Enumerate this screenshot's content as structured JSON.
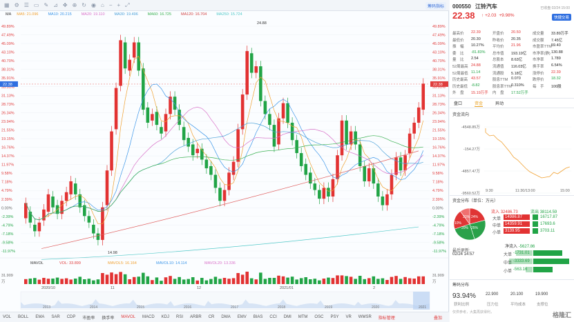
{
  "toolbar": {
    "label": "筹码指标",
    "icons": [
      "grid-icon",
      "settings-icon",
      "menu-icon",
      "screen-icon",
      "brush-icon",
      "ruler-icon",
      "cursor-icon",
      "zoom-icon",
      "refresh-icon",
      "eye-icon",
      "lock-icon",
      "minus-icon",
      "plus-icon",
      "expand-icon"
    ]
  },
  "ma": {
    "label": "MA",
    "items": [
      {
        "label": "MA5: 21.096",
        "color": "#f0a030"
      },
      {
        "label": "MA10: 20.215",
        "color": "#3a95e8"
      },
      {
        "label": "MA20: 19.110",
        "color": "#d870c8"
      },
      {
        "label": "MA30: 19.496",
        "color": "#4aa0d8"
      },
      {
        "label": "MA60: 16.725",
        "color": "#38b050"
      },
      {
        "label": "MA120: 16.704",
        "color": "#d04040"
      },
      {
        "label": "MA250: 15.724",
        "color": "#50c8c8"
      }
    ]
  },
  "vol": {
    "label": "MAVOL",
    "items": [
      {
        "label": "VOL: 33.899",
        "color": "#e03c3c"
      },
      {
        "label": "MAVOL5: 16.164",
        "color": "#f0a030"
      },
      {
        "label": "MAVOL10: 14.114",
        "color": "#3a95e8"
      },
      {
        "label": "MAVOL20: 13.336",
        "color": "#d870c8"
      }
    ],
    "axis_top": "31.909",
    "axis_unit": "万"
  },
  "chart_data": {
    "type": "candlestick",
    "left_ticks": [
      "49.89%",
      "47.49%",
      "45.09%",
      "43.10%",
      "40.70%",
      "38.31%",
      "35.91%",
      "33.51%",
      "31.13%",
      "28.73%",
      "26.34%",
      "23.94%",
      "21.55%",
      "19.15%",
      "16.76%",
      "14.37%",
      "11.97%",
      "9.58%",
      "7.18%",
      "4.79%",
      "2.39%",
      "0.00%",
      "-2.39%",
      "-4.79%",
      "-7.18%",
      "-9.58%",
      "-11.97%"
    ],
    "right_ticks": [
      "49.89%",
      "47.49%",
      "45.09%",
      "43.10%",
      "40.70%",
      "38.31%",
      "35.91%",
      "33.51%",
      "31.13%",
      "28.73%",
      "26.34%",
      "23.94%",
      "21.55%",
      "19.15%",
      "16.76%",
      "14.37%",
      "11.97%",
      "9.58%",
      "7.18%",
      "4.79%",
      "2.39%",
      "0.00%",
      "-2.39%",
      "-4.79%",
      "-7.18%",
      "-9.58%",
      "-11.97%"
    ],
    "current_price_label": "22.38",
    "high_label": "24.88",
    "low_label": "14.98",
    "x_labels_main": [
      "2020/10",
      "11",
      "12",
      "2021/01",
      "2"
    ],
    "x_labels_overview": [
      "2013",
      "2014",
      "2015",
      "2016",
      "2017",
      "2018",
      "2019",
      "2020",
      "2021"
    ],
    "candles": [
      [
        16.2,
        16.9
      ],
      [
        16.5,
        16.0
      ],
      [
        15.9,
        15.6
      ],
      [
        15.6,
        16.0
      ],
      [
        16.1,
        16.6
      ],
      [
        16.5,
        17.3
      ],
      [
        17.2,
        16.7
      ],
      [
        16.8,
        16.4
      ],
      [
        16.4,
        17.0
      ],
      [
        17.0,
        17.4
      ],
      [
        17.3,
        17.9
      ],
      [
        17.8,
        17.3
      ],
      [
        17.3,
        16.7
      ],
      [
        16.8,
        16.3
      ],
      [
        16.3,
        16.0
      ],
      [
        15.9,
        15.5
      ],
      [
        15.5,
        15.2
      ],
      [
        15.2,
        16.7
      ],
      [
        16.8,
        18.4
      ],
      [
        18.4,
        20.2
      ],
      [
        20.3,
        22.2
      ],
      [
        22.3,
        24.4
      ],
      [
        24.3,
        23.1
      ],
      [
        23.0,
        23.5
      ],
      [
        23.6,
        24.3
      ],
      [
        24.3,
        23.0
      ],
      [
        23.1,
        21.2
      ],
      [
        21.3,
        20.6
      ],
      [
        20.7,
        21.0
      ],
      [
        21.1,
        20.5
      ],
      [
        20.4,
        20.1
      ],
      [
        20.2,
        21.0
      ],
      [
        21.0,
        21.8
      ],
      [
        21.8,
        21.2
      ],
      [
        21.2,
        20.5
      ],
      [
        20.4,
        19.8
      ],
      [
        19.9,
        19.5
      ],
      [
        19.6,
        19.1
      ],
      [
        19.2,
        19.4
      ],
      [
        19.4,
        18.9
      ],
      [
        18.9,
        18.5
      ],
      [
        18.6,
        18.2
      ],
      [
        18.2,
        17.6
      ],
      [
        17.6,
        17.0
      ],
      [
        17.0,
        17.5
      ],
      [
        17.5,
        18.3
      ],
      [
        18.2,
        18.8
      ],
      [
        18.8,
        20.3
      ],
      [
        20.3,
        21.9
      ],
      [
        21.9,
        23.9
      ],
      [
        23.8,
        22.9
      ],
      [
        22.9,
        23.2
      ],
      [
        23.2,
        21.6
      ],
      [
        21.6,
        21.0
      ],
      [
        21.0,
        20.5
      ],
      [
        20.5,
        19.5
      ],
      [
        19.6,
        20.8
      ],
      [
        20.8,
        21.5
      ],
      [
        21.5,
        20.6
      ],
      [
        20.6,
        19.8
      ],
      [
        19.8,
        19.2
      ],
      [
        19.2,
        18.6
      ],
      [
        18.7,
        18.2
      ],
      [
        18.3,
        17.8
      ],
      [
        17.8,
        17.5
      ],
      [
        17.5,
        17.1
      ],
      [
        17.1,
        17.6
      ],
      [
        17.6,
        17.2
      ],
      [
        17.2,
        18.0
      ],
      [
        18.0,
        19.1
      ],
      [
        19.1,
        20.7
      ],
      [
        20.7,
        19.6
      ],
      [
        19.6,
        20.2
      ],
      [
        20.2,
        19.6
      ],
      [
        19.6,
        18.6
      ],
      [
        18.6,
        17.9
      ],
      [
        17.9,
        18.5
      ],
      [
        18.5,
        17.8
      ],
      [
        17.8,
        17.2
      ],
      [
        17.2,
        16.8
      ],
      [
        16.8,
        17.3
      ],
      [
        17.3,
        18.2
      ],
      [
        18.2,
        19.0
      ],
      [
        19.0,
        18.4
      ],
      [
        18.4,
        19.1
      ],
      [
        19.2,
        20.1
      ],
      [
        20.1,
        20.6
      ],
      [
        20.6,
        21.3
      ],
      [
        21.2,
        22.4
      ]
    ]
  },
  "quote": {
    "code": "000550",
    "name": "江铃汽车",
    "price": "22.38",
    "change": "+2.03",
    "pct": "+9.98%",
    "status": "已收盘 02/24 15:00",
    "quick_trade": "快捷交易",
    "table": [
      [
        [
          "最高价",
          "22.39",
          "red"
        ],
        [
          "开盘价",
          "20.50",
          "red"
        ],
        [
          "成交量",
          "33.89万手",
          "dark"
        ]
      ],
      [
        [
          "最低价",
          "20.30",
          "dark"
        ],
        [
          "昨收价",
          "20.35",
          "dark"
        ],
        [
          "成交额",
          "7.45亿",
          "dark"
        ]
      ],
      [
        [
          "振　幅",
          "10.27%",
          "dark"
        ],
        [
          "平均价",
          "21.96",
          "red"
        ],
        [
          "市盈率TTM",
          "59.40",
          "dark"
        ]
      ],
      [
        [
          "委　比",
          "-81.83%",
          "green"
        ],
        [
          "总市值",
          "193.19亿",
          "dark"
        ],
        [
          "市净率(静)",
          "130.88",
          "dark"
        ]
      ],
      [
        [
          "量　比",
          "2.54",
          "dark"
        ],
        [
          "总股本",
          "8.63亿",
          "dark"
        ],
        [
          "市净率",
          "1.789",
          "dark"
        ]
      ],
      [
        [
          "52周最高",
          "24.88",
          "red"
        ],
        [
          "流通值",
          "116.03亿",
          "dark"
        ],
        [
          "换手率",
          "6.54%",
          "dark"
        ]
      ],
      [
        [
          "52周最低",
          "11.14",
          "green"
        ],
        [
          "流通股",
          "5.18亿",
          "dark"
        ],
        [
          "涨停价",
          "22.39",
          "red"
        ]
      ],
      [
        [
          "历史最高",
          "43.57",
          "red"
        ],
        [
          "股息TTM",
          "0.070",
          "dark"
        ],
        [
          "跌停价",
          "18.32",
          "green"
        ]
      ],
      [
        [
          "历史最低",
          "-8.82",
          "green"
        ],
        [
          "股息率TTM",
          "0.310%",
          "dark"
        ],
        [
          "每　手",
          "100股",
          "dark"
        ]
      ],
      [
        [
          "外　盘",
          "15.19万手",
          "red"
        ],
        [
          "内　盘",
          "17.52万手",
          "green"
        ],
        [
          "",
          "",
          ""
        ]
      ]
    ]
  },
  "tabs": [
    "盘口",
    "资金",
    "异动"
  ],
  "flow": {
    "title": "资金流向",
    "y_labels": [
      "-4548.85万",
      "-154.27万",
      "-4857.47万",
      "-9560.52万"
    ],
    "x_labels": [
      "9:30",
      "11:30/13:00",
      "15:00"
    ]
  },
  "dist": {
    "title": "资金分布（单位：万元）",
    "pie": [
      {
        "label": "21%",
        "value": 21,
        "color": "#e03535"
      },
      {
        "label": "24%",
        "value": 24,
        "color": "#2aa14a"
      },
      {
        "label": "25%",
        "value": 25,
        "color": "#2aa14a"
      },
      {
        "label": "20%",
        "value": 20,
        "color": "#e03535"
      },
      {
        "label": "10%",
        "value": 10,
        "color": "#f07070"
      }
    ],
    "in_label": "流入",
    "in_total": "32486.73",
    "out_label": "流出",
    "out_total": "38114.59",
    "rows": [
      {
        "label": "大单",
        "in": "14986.87",
        "out": "16717.87"
      },
      {
        "label": "中单",
        "in": "14359.91",
        "out": "17693.6"
      },
      {
        "label": "小单",
        "in": "3139.95",
        "out": "3703.11"
      }
    ]
  },
  "net": {
    "title": "最后更新:",
    "time": "02/24 14:57",
    "net_label": "净流入",
    "net_value": "-5627.86",
    "rows": [
      {
        "label": "大单",
        "value": "-1731.01"
      },
      {
        "label": "中单",
        "value": "-3333.69"
      },
      {
        "label": "小单",
        "value": "-563.16"
      }
    ]
  },
  "chip": {
    "title": "筹码分布",
    "pct": "93.94%",
    "pct_label": "获利比例",
    "v1": "22.900",
    "l1": "压力位",
    "v2": "20.100",
    "l2": "平均成本",
    "v3": "19.900",
    "l3": "支撑位",
    "note": "仅供参考，大集再获得利，"
  },
  "bottom_tabs": [
    "VOL",
    "BOLL",
    "EMA",
    "SAR",
    "CDP",
    "市盈率",
    "换手率",
    "MAVOL",
    "MACD",
    "KDJ",
    "RSI",
    "ARBR",
    "CR",
    "DMA",
    "EMV",
    "BIAS",
    "CCI",
    "DMI",
    "MTM",
    "OSC",
    "PSY",
    "VR",
    "WMSR",
    "指标管理"
  ],
  "bottom_right": "叠加",
  "watermark": "格隆汇"
}
